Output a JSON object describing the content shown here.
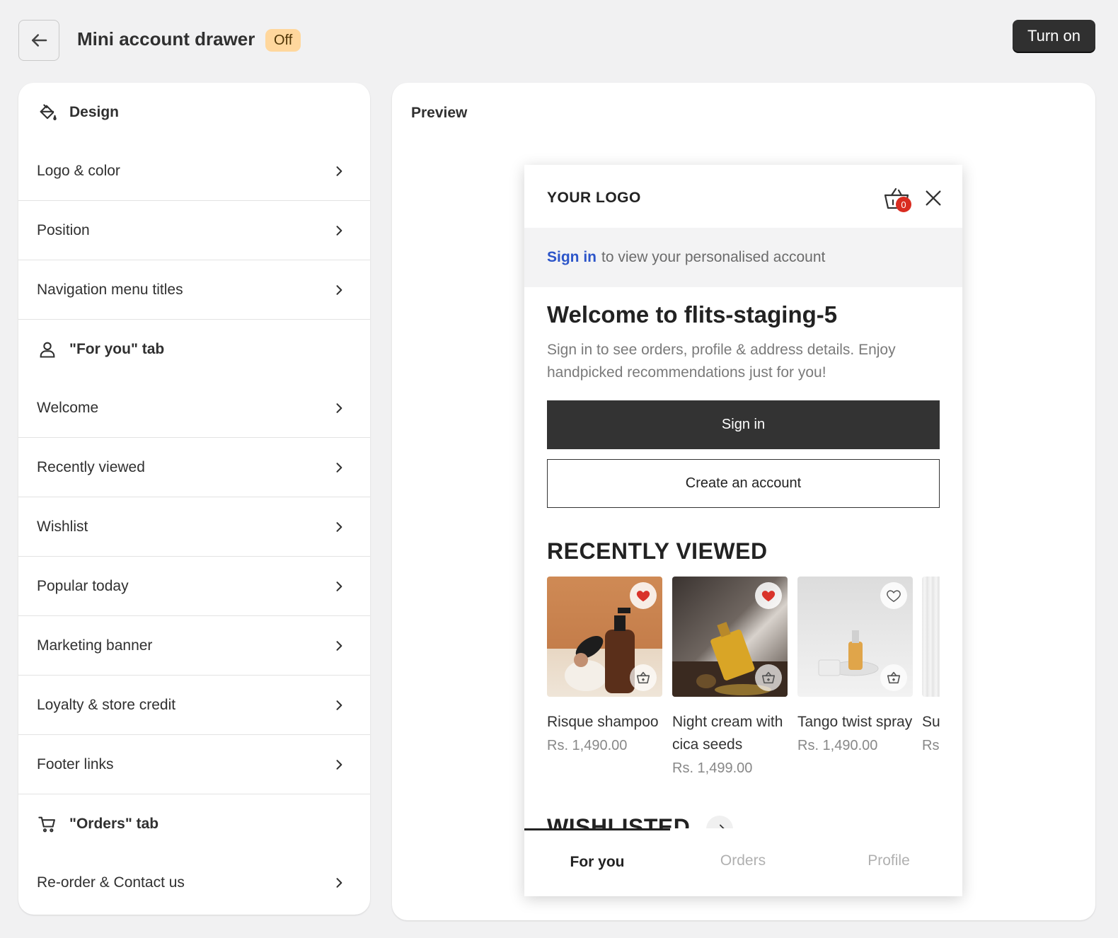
{
  "header": {
    "title": "Mini account drawer",
    "status": "Off",
    "turn_on_label": "Turn on"
  },
  "sidebar": {
    "sections": [
      {
        "title": "Design",
        "icon": "paint-bucket-icon",
        "items": [
          "Logo & color",
          "Position",
          "Navigation menu titles"
        ]
      },
      {
        "title": "\"For you\" tab",
        "icon": "person-icon",
        "items": [
          "Welcome",
          "Recently viewed",
          "Wishlist",
          "Popular today",
          "Marketing banner",
          "Loyalty & store credit",
          "Footer links"
        ]
      },
      {
        "title": "\"Orders\" tab",
        "icon": "cart-icon",
        "items": [
          "Re-order & Contact us"
        ]
      }
    ]
  },
  "preview": {
    "label": "Preview",
    "drawer": {
      "logo": "YOUR LOGO",
      "cart_count": "0",
      "signin_link": "Sign in",
      "signin_text": "to view your personalised account",
      "welcome_title": "Welcome to flits-staging-5",
      "welcome_text": "Sign in to see orders, profile & address details. Enjoy handpicked recommendations just for you!",
      "signin_button": "Sign in",
      "create_button": "Create an account",
      "recently_viewed_title": "RECENTLY VIEWED",
      "products": [
        {
          "name": "Risque shampoo",
          "price": "Rs. 1,490.00",
          "wishlisted": true
        },
        {
          "name": "Night cream with cica seeds",
          "price": "Rs. 1,499.00",
          "wishlisted": true
        },
        {
          "name": "Tango twist spray",
          "price": "Rs. 1,490.00",
          "wishlisted": false
        },
        {
          "name": "Su",
          "price": "Rs",
          "wishlisted": false
        }
      ],
      "wishlisted_title": "WISHLISTED",
      "tabs": [
        "For you",
        "Orders",
        "Profile"
      ],
      "active_tab": "For you"
    }
  },
  "colors": {
    "background": "#f1f1f2",
    "badge_off": "#ffd79d",
    "primary_button": "#303030",
    "link": "#2c55c9",
    "heart_red": "#d9332a",
    "cart_badge": "#d92c20"
  }
}
